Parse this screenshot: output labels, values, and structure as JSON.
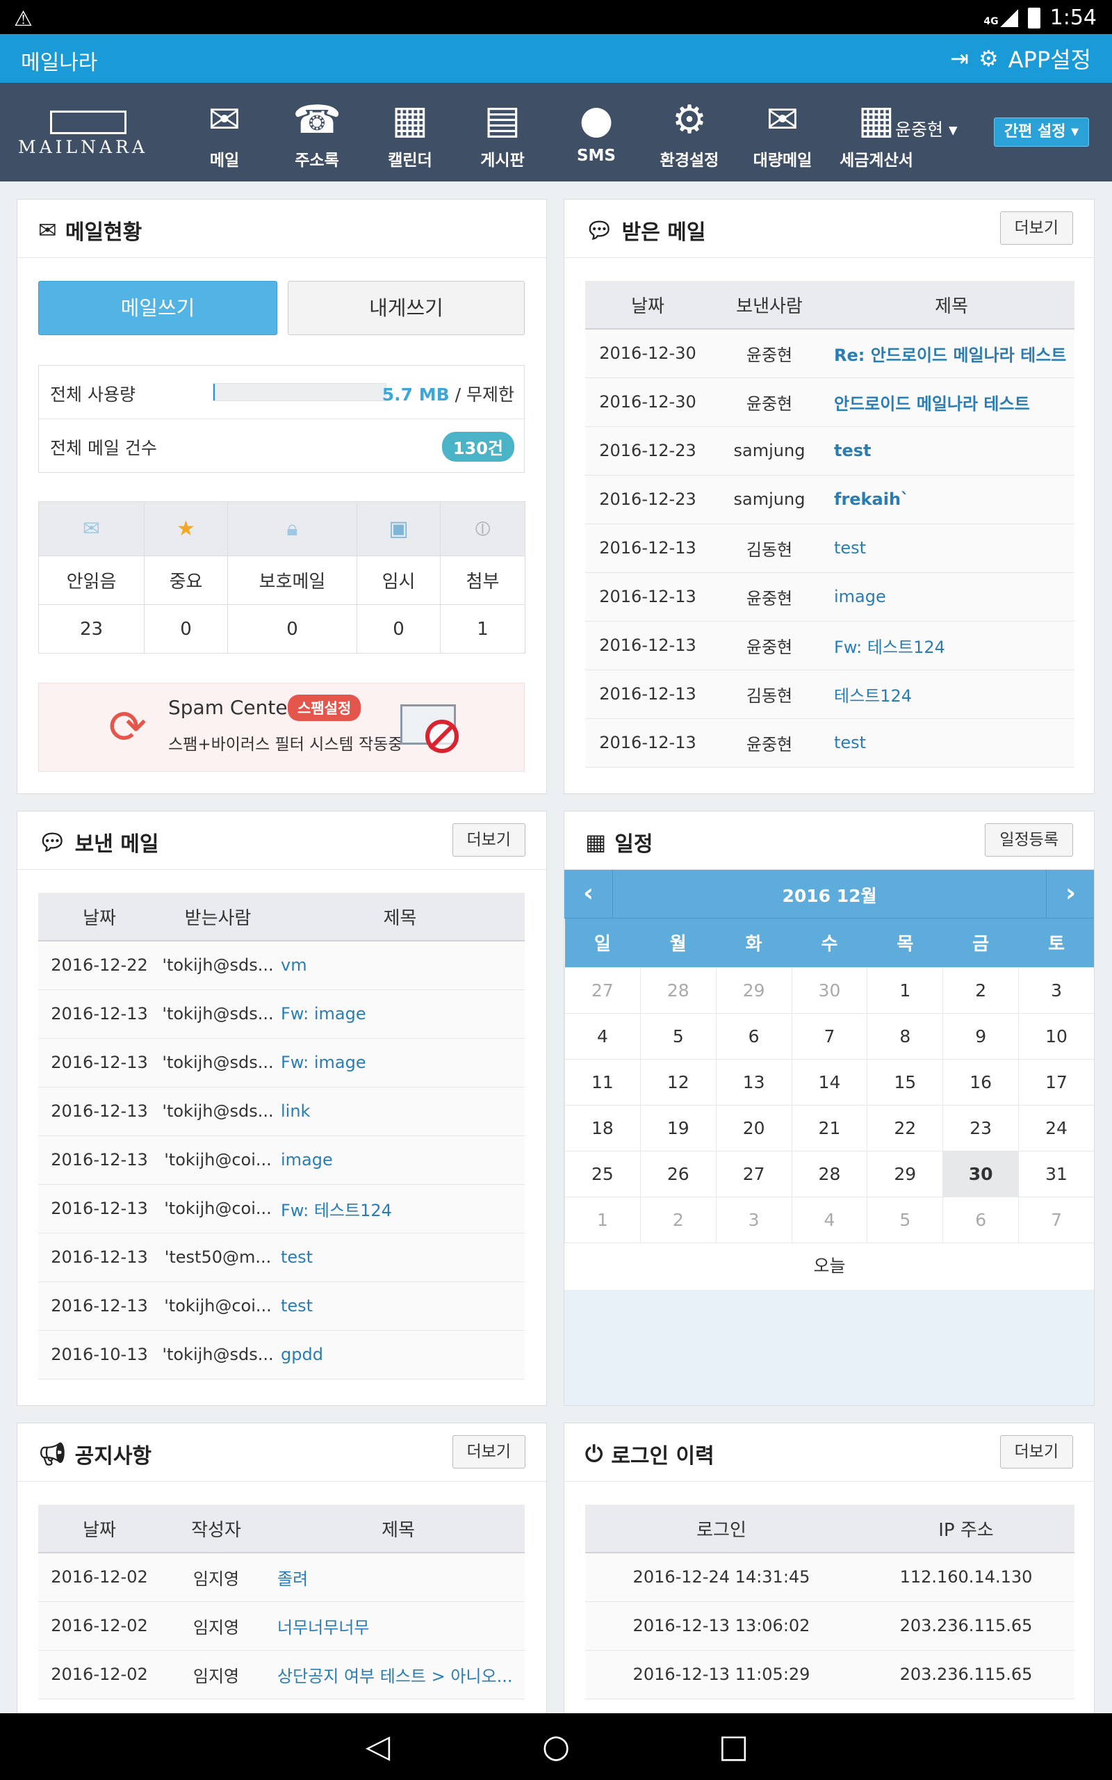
{
  "status": {
    "time": "1:54",
    "network": "4G"
  },
  "appbar": {
    "title": "메일나라",
    "settings": "APP설정"
  },
  "nav": {
    "logo": "MAILNARA",
    "items": [
      {
        "label": "메일",
        "icon": "mail-icon"
      },
      {
        "label": "주소록",
        "icon": "addressbook-icon"
      },
      {
        "label": "캘린더",
        "icon": "calendar-icon"
      },
      {
        "label": "게시판",
        "icon": "board-icon"
      },
      {
        "label": "SMS",
        "icon": "sms-icon"
      },
      {
        "label": "환경설정",
        "icon": "gear-icon"
      },
      {
        "label": "대량메일",
        "icon": "bulk-mail-icon"
      },
      {
        "label": "세금계산서",
        "icon": "calculator-icon"
      }
    ],
    "user": "윤중현",
    "quick": "간편 설정"
  },
  "mailstatus": {
    "title": "메일현황",
    "compose": "메일쓰기",
    "self": "내게쓰기",
    "usage_label": "전체 사용량",
    "usage_value": "5.7 MB",
    "usage_limit": " / 무제한",
    "usage_fraction": 0.01,
    "count_label": "전체 메일 건수",
    "count": "130건",
    "stats": {
      "labels": [
        "안읽음",
        "중요",
        "보호메일",
        "임시",
        "첨부"
      ],
      "values": [
        "23",
        "0",
        "0",
        "0",
        "1"
      ]
    },
    "spam": {
      "title": "Spam Center",
      "tag": "스팸설정",
      "desc": "스팸+바이러스 필터 시스템 작동중"
    }
  },
  "inbox": {
    "title": "받은 메일",
    "more": "더보기",
    "headers": [
      "날짜",
      "보낸사람",
      "제목"
    ],
    "rows": [
      [
        "2016-12-30",
        "윤중현",
        "Re: 안드로이드 메일나라 테스트"
      ],
      [
        "2016-12-30",
        "윤중현",
        "안드로이드 메일나라 테스트"
      ],
      [
        "2016-12-23",
        "samjung",
        "test"
      ],
      [
        "2016-12-23",
        "samjung",
        "frekaih`"
      ],
      [
        "2016-12-13",
        "김동현",
        "test"
      ],
      [
        "2016-12-13",
        "윤중현",
        "image"
      ],
      [
        "2016-12-13",
        "윤중현",
        "Fw: 테스트124"
      ],
      [
        "2016-12-13",
        "김동현",
        "테스트124"
      ],
      [
        "2016-12-13",
        "윤중현",
        "test"
      ]
    ]
  },
  "sent": {
    "title": "보낸 메일",
    "more": "더보기",
    "headers": [
      "날짜",
      "받는사람",
      "제목"
    ],
    "rows": [
      [
        "2016-12-22",
        "'tokijh@sds...",
        "vm"
      ],
      [
        "2016-12-13",
        "'tokijh@sds...",
        "Fw: image"
      ],
      [
        "2016-12-13",
        "'tokijh@sds...",
        "Fw: image"
      ],
      [
        "2016-12-13",
        "'tokijh@sds...",
        "link"
      ],
      [
        "2016-12-13",
        "'tokijh@coi...",
        "image"
      ],
      [
        "2016-12-13",
        "'tokijh@coi...",
        "Fw: 테스트124"
      ],
      [
        "2016-12-13",
        "'test50@m...",
        "test"
      ],
      [
        "2016-12-13",
        "'tokijh@coi...",
        "test"
      ],
      [
        "2016-10-13",
        "'tokijh@sds...",
        "gpdd"
      ]
    ]
  },
  "schedule": {
    "title": "일정",
    "add": "일정등록",
    "month": "2016 12월",
    "weekdays": [
      "일",
      "월",
      "화",
      "수",
      "목",
      "금",
      "토"
    ],
    "weeks": [
      [
        "27",
        "28",
        "29",
        "30",
        "1",
        "2",
        "3"
      ],
      [
        "4",
        "5",
        "6",
        "7",
        "8",
        "9",
        "10"
      ],
      [
        "11",
        "12",
        "13",
        "14",
        "15",
        "16",
        "17"
      ],
      [
        "18",
        "19",
        "20",
        "21",
        "22",
        "23",
        "24"
      ],
      [
        "25",
        "26",
        "27",
        "28",
        "29",
        "30",
        "31"
      ],
      [
        "1",
        "2",
        "3",
        "4",
        "5",
        "6",
        "7"
      ]
    ],
    "today_label": "오늘"
  },
  "notice": {
    "title": "공지사항",
    "more": "더보기",
    "headers": [
      "날짜",
      "작성자",
      "제목"
    ],
    "rows": [
      [
        "2016-12-02",
        "임지영",
        "졸려"
      ],
      [
        "2016-12-02",
        "임지영",
        "너무너무너무"
      ],
      [
        "2016-12-02",
        "임지영",
        "상단공지 여부 테스트 > 아니오..."
      ]
    ]
  },
  "login": {
    "title": "로그인 이력",
    "more": "더보기",
    "headers": [
      "로그인",
      "IP 주소"
    ],
    "rows": [
      [
        "2016-12-24 14:31:45",
        "112.160.14.130"
      ],
      [
        "2016-12-13 13:06:02",
        "203.236.115.65"
      ],
      [
        "2016-12-13 11:05:29",
        "203.236.115.65"
      ]
    ]
  },
  "colors": {
    "appbar": "#1a9ad7",
    "nav": "#3f4f66",
    "link": "#2a7db3",
    "calendar": "#5dacdb",
    "spam": "#e4564b"
  }
}
